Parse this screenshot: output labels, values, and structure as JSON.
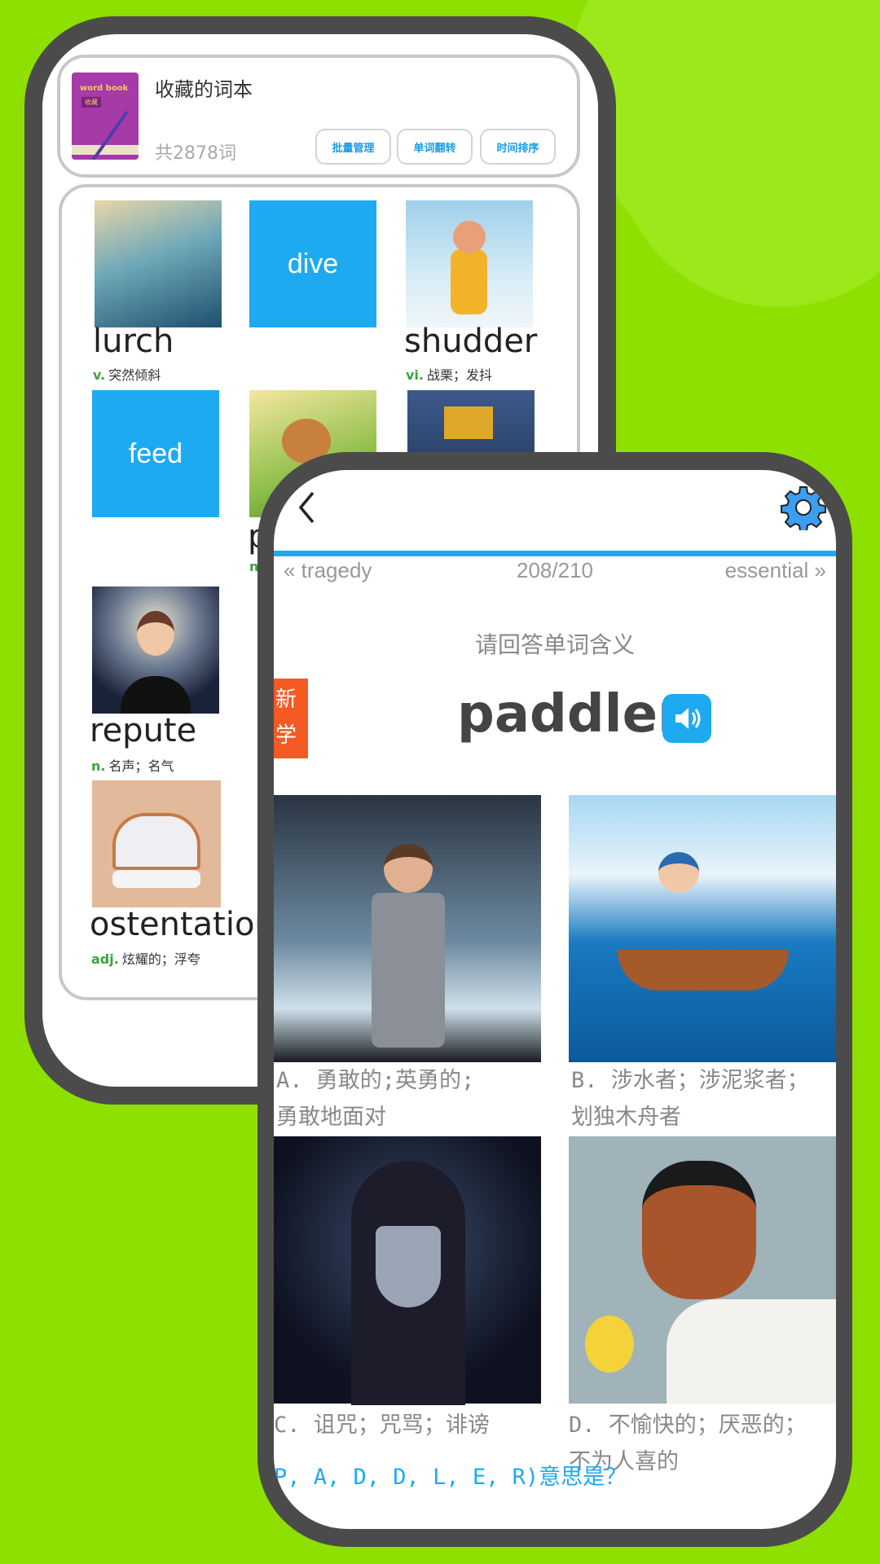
{
  "wordbook": {
    "cover_title": "word book",
    "cover_tag": "收藏",
    "title": "收藏的词本",
    "count": "共2878词",
    "buttons": [
      "批量管理",
      "单词翻转",
      "时间排序"
    ]
  },
  "words": [
    {
      "word": "lurch",
      "pos": "v.",
      "meaning": "突然倾斜",
      "image": "ship-in-wave"
    },
    {
      "word": "dive",
      "text_tile": true
    },
    {
      "word": "shudder",
      "pos": "vi.",
      "meaning": "战栗；发抖",
      "image": "shivering-boy"
    },
    {
      "word": "feed",
      "text_tile": true
    },
    {
      "word": "p",
      "pos": "n",
      "meaning": "",
      "image": "puppy"
    },
    {
      "word": "",
      "image": "king"
    },
    {
      "word": "repute",
      "pos": "n.",
      "meaning": "名声；名气",
      "image": "celebrity"
    },
    {
      "word": "ostentatiou",
      "pos": "adj.",
      "meaning": "炫耀的；浮夸",
      "image": "crown"
    }
  ],
  "quiz": {
    "prev_word": "« tragedy",
    "progress": "208/210",
    "next_word": "essential »",
    "progress_fraction": 0.99,
    "prompt": "请回答单词含义",
    "tag": "新学",
    "word": "paddler",
    "options": [
      {
        "label": "A. 勇敢的;英勇的;",
        "label2": "勇敢地面对",
        "image": "knight"
      },
      {
        "label": "B. 涉水者；涉泥浆者；",
        "label2": "划独木舟者",
        "image": "canoe-paddler"
      },
      {
        "label": "C. 诅咒；咒骂；诽谤",
        "label2": "",
        "image": "wizard"
      },
      {
        "label": "D. 不愉快的；厌恶的；",
        "label2": "不为人喜的",
        "image": "sour-face"
      }
    ],
    "spelling_hint": "P, A, D, D, L, E, R)意思是？"
  },
  "colors": {
    "background": "#8de000",
    "accent": "#1eaaf1",
    "tag": "#f45a22",
    "pos": "#3aa33a"
  }
}
